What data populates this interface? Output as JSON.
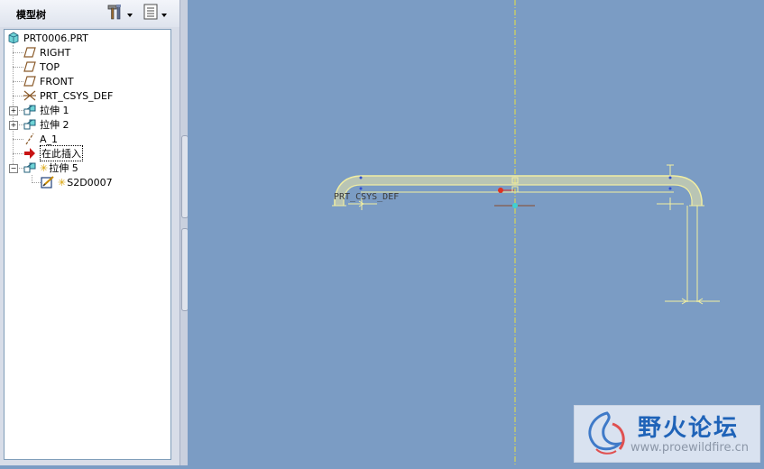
{
  "panel": {
    "title": "模型树",
    "tools": [
      {
        "name": "settings-tools",
        "icon": "hammer-wrench-icon"
      },
      {
        "name": "show-options",
        "icon": "list-view-icon"
      }
    ]
  },
  "tree": {
    "root": {
      "label": "PRT0006.PRT",
      "icon": "part-icon"
    },
    "items": [
      {
        "label": "RIGHT",
        "icon": "datum-plane-icon"
      },
      {
        "label": "TOP",
        "icon": "datum-plane-icon"
      },
      {
        "label": "FRONT",
        "icon": "datum-plane-icon"
      },
      {
        "label": "PRT_CSYS_DEF",
        "icon": "csys-icon"
      },
      {
        "label": "拉伸 1",
        "icon": "extrude-icon"
      },
      {
        "label": "拉伸 2",
        "icon": "extrude-icon"
      },
      {
        "label": "A_1",
        "icon": "axis-icon"
      },
      {
        "label": "在此插入",
        "icon": "insert-here-arrow-icon"
      },
      {
        "label": "拉伸 5",
        "icon": "extrude-icon"
      },
      {
        "label": "S2D0007",
        "icon": "sketch-icon"
      }
    ]
  },
  "viewport": {
    "csys_label": "PRT_CSYS_DEF",
    "colors": {
      "background": "#7b9cc4",
      "sketch": "#f3f0a0",
      "centerline": "#e8e040"
    }
  },
  "watermark": {
    "title": "野火论坛",
    "url": "www.proewildfire.cn"
  }
}
